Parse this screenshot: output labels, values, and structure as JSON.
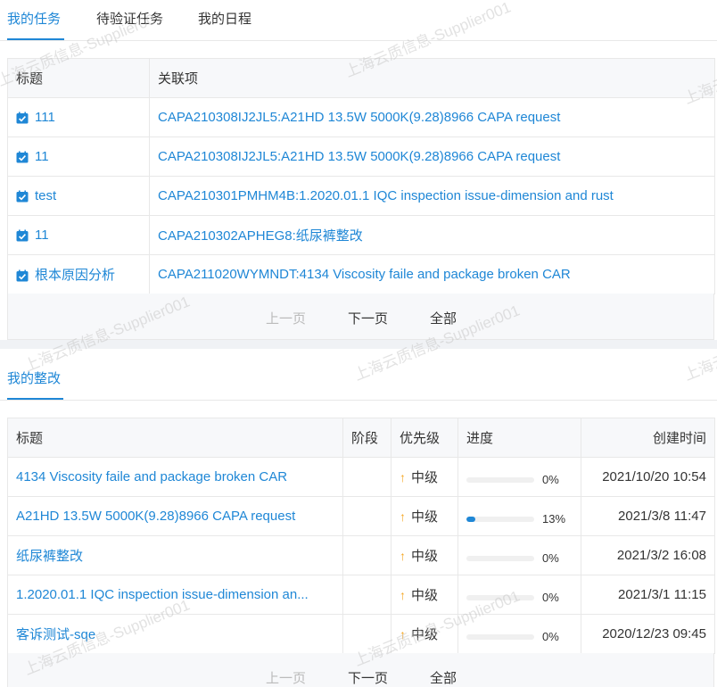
{
  "tabs": [
    {
      "label": "我的任务"
    },
    {
      "label": "待验证任务"
    },
    {
      "label": "我的日程"
    }
  ],
  "tasks": {
    "headers": {
      "title": "标题",
      "related": "关联项"
    },
    "rows": [
      {
        "title": "111",
        "related": "CAPA210308IJ2JL5:A21HD 13.5W 5000K(9.28)8966 CAPA request"
      },
      {
        "title": "11",
        "related": "CAPA210308IJ2JL5:A21HD 13.5W 5000K(9.28)8966 CAPA request"
      },
      {
        "title": "test",
        "related": "CAPA210301PMHM4B:1.2020.01.1 IQC inspection issue-dimension and rust"
      },
      {
        "title": "11",
        "related": "CAPA210302APHEG8:纸尿裤整改"
      },
      {
        "title": "根本原因分析",
        "related": "CAPA211020WYMNDT:4134 Viscosity faile and package broken CAR"
      }
    ]
  },
  "pager": {
    "prev": "上一页",
    "next": "下一页",
    "all": "全部"
  },
  "rectification": {
    "title": "我的整改",
    "headers": {
      "title": "标题",
      "stage": "阶段",
      "priority": "优先级",
      "progress": "进度",
      "created": "创建时间"
    },
    "rows": [
      {
        "title": "4134 Viscosity faile and package broken CAR",
        "stage": "",
        "priority": "中级",
        "progress": 0,
        "progress_label": "0%",
        "created": "2021/10/20 10:54"
      },
      {
        "title": "A21HD 13.5W 5000K(9.28)8966 CAPA request",
        "stage": "",
        "priority": "中级",
        "progress": 13,
        "progress_label": "13%",
        "created": "2021/3/8 11:47"
      },
      {
        "title": "纸尿裤整改",
        "stage": "",
        "priority": "中级",
        "progress": 0,
        "progress_label": "0%",
        "created": "2021/3/2 16:08"
      },
      {
        "title": "1.2020.01.1 IQC inspection issue-dimension an...",
        "stage": "",
        "priority": "中级",
        "progress": 0,
        "progress_label": "0%",
        "created": "2021/3/1 11:15"
      },
      {
        "title": "客诉测试-sqe",
        "stage": "",
        "priority": "中级",
        "progress": 0,
        "progress_label": "0%",
        "created": "2020/12/23 09:45"
      }
    ]
  },
  "watermark": "上海云质信息-Supplier001",
  "colors": {
    "accent": "#1f87d6",
    "priority": "#f5a623",
    "header_bg": "#f7f8fa"
  }
}
